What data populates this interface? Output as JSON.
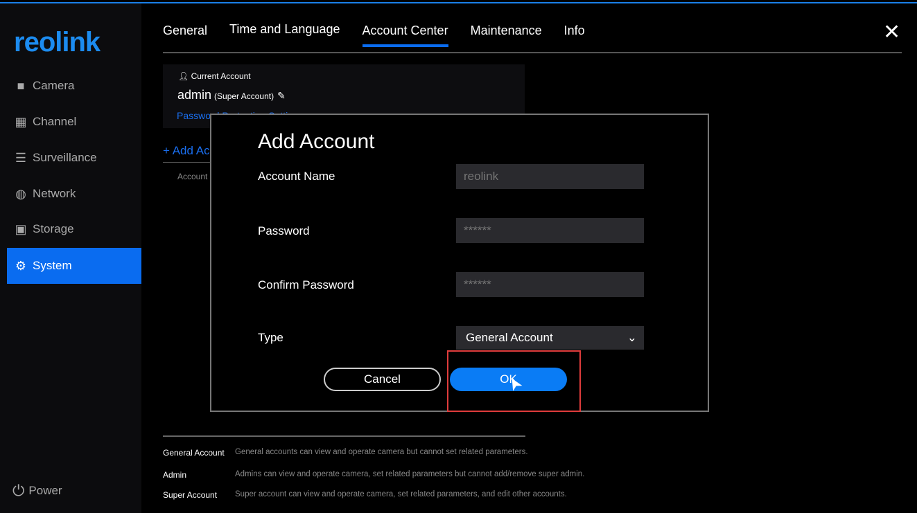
{
  "logo": "reolink",
  "sidebar": {
    "items": [
      {
        "label": "Camera",
        "icon": "camera-icon"
      },
      {
        "label": "Channel",
        "icon": "grid-icon"
      },
      {
        "label": "Surveillance",
        "icon": "list-icon"
      },
      {
        "label": "Network",
        "icon": "globe-icon"
      },
      {
        "label": "Storage",
        "icon": "storage-icon"
      },
      {
        "label": "System",
        "icon": "gear-icon",
        "active": true
      }
    ],
    "power": "Power"
  },
  "tabs": [
    {
      "label": "General"
    },
    {
      "label": "Time and Language"
    },
    {
      "label": "Account Center",
      "active": true
    },
    {
      "label": "Maintenance"
    },
    {
      "label": "Info"
    }
  ],
  "current": {
    "label": "Current Account",
    "name": "admin",
    "role": "(Super Account)",
    "link": "Password Protection Settings"
  },
  "add_account": "+ Add Account",
  "account_col": "Account",
  "legend": [
    {
      "k": "General Account",
      "v": "General accounts can view and operate camera but cannot set related parameters."
    },
    {
      "k": "Admin",
      "v": "Admins can view and operate camera, set related parameters but cannot add/remove super admin."
    },
    {
      "k": "Super Account",
      "v": "Super account can view and operate camera, set related parameters, and edit other accounts."
    }
  ],
  "modal": {
    "title": "Add Account",
    "account_name_label": "Account Name",
    "account_name_placeholder": "reolink",
    "password_label": "Password",
    "password_placeholder": "******",
    "confirm_label": "Confirm Password",
    "confirm_placeholder": "******",
    "type_label": "Type",
    "type_value": "General Account",
    "cancel": "Cancel",
    "ok": "OK"
  },
  "colors": {
    "accent": "#0a6cf0",
    "highlight": "#e03c3c"
  }
}
